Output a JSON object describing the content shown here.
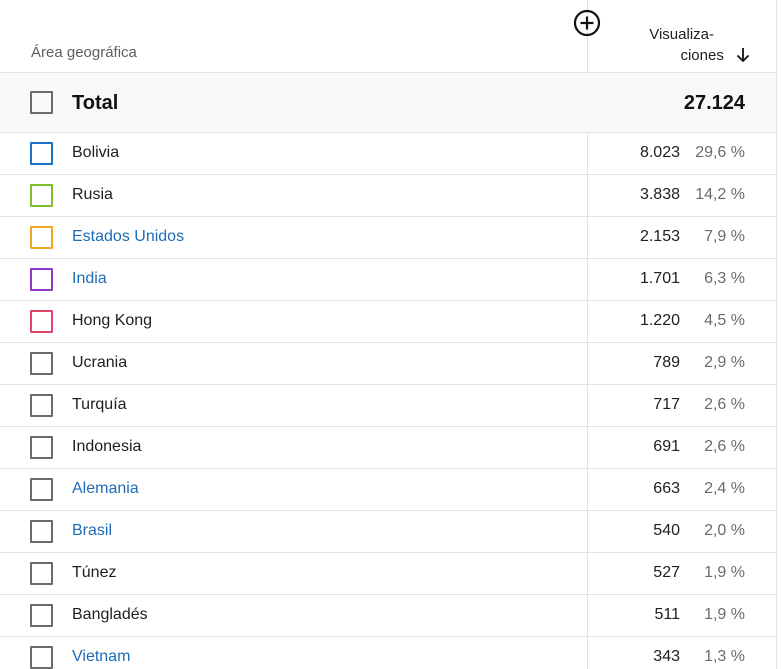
{
  "header": {
    "geo_label": "Área geográfica",
    "views_line1": "Visualiza-",
    "views_line2": "ciones",
    "add_icon": "circle-plus-icon",
    "sort_icon": "arrow-down-icon"
  },
  "total": {
    "label": "Total",
    "value": "27.124"
  },
  "colors": {
    "link": "#1f6bb5",
    "default_checkbox": "#6b6b6b"
  },
  "rows": [
    {
      "name": "Bolivia",
      "value": "8.023",
      "pct": "29,6 %",
      "link": false,
      "color": "#1a73c8"
    },
    {
      "name": "Rusia",
      "value": "3.838",
      "pct": "14,2 %",
      "link": false,
      "color": "#7cc02a"
    },
    {
      "name": "Estados Unidos",
      "value": "2.153",
      "pct": "7,9 %",
      "link": true,
      "color": "#f0a529"
    },
    {
      "name": "India",
      "value": "1.701",
      "pct": "6,3 %",
      "link": true,
      "color": "#8f3bc8"
    },
    {
      "name": "Hong Kong",
      "value": "1.220",
      "pct": "4,5 %",
      "link": false,
      "color": "#e0456a"
    },
    {
      "name": "Ucrania",
      "value": "789",
      "pct": "2,9 %",
      "link": false,
      "color": "#6b6b6b"
    },
    {
      "name": "Turquía",
      "value": "717",
      "pct": "2,6 %",
      "link": false,
      "color": "#6b6b6b"
    },
    {
      "name": "Indonesia",
      "value": "691",
      "pct": "2,6 %",
      "link": false,
      "color": "#6b6b6b"
    },
    {
      "name": "Alemania",
      "value": "663",
      "pct": "2,4 %",
      "link": true,
      "color": "#6b6b6b"
    },
    {
      "name": "Brasil",
      "value": "540",
      "pct": "2,0 %",
      "link": true,
      "color": "#6b6b6b"
    },
    {
      "name": "Túnez",
      "value": "527",
      "pct": "1,9 %",
      "link": false,
      "color": "#6b6b6b"
    },
    {
      "name": "Bangladés",
      "value": "511",
      "pct": "1,9 %",
      "link": false,
      "color": "#6b6b6b"
    },
    {
      "name": "Vietnam",
      "value": "343",
      "pct": "1,3 %",
      "link": true,
      "color": "#6b6b6b"
    }
  ]
}
